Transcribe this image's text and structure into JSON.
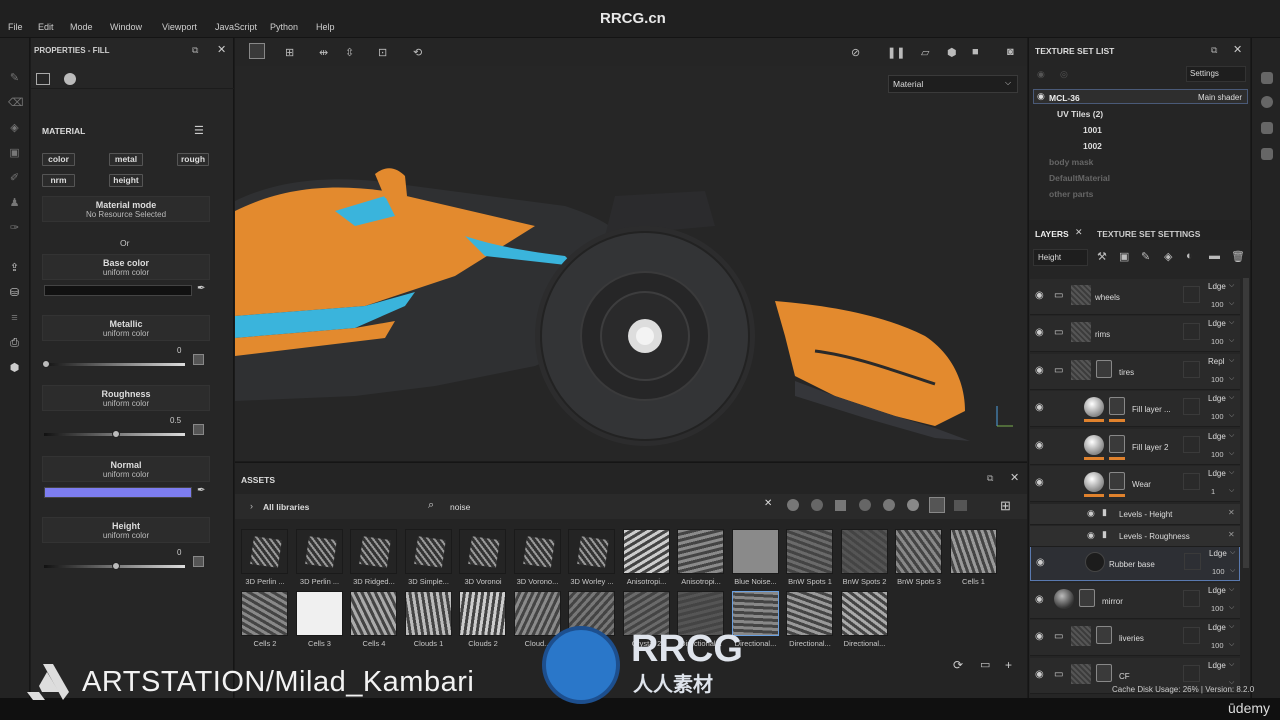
{
  "watermark": "RRCG.cn",
  "menu": [
    "File",
    "Edit",
    "Mode",
    "Window",
    "Viewport",
    "JavaScript",
    "Python",
    "Help"
  ],
  "properties": {
    "title": "PROPERTIES - FILL",
    "material_heading": "MATERIAL",
    "channels": [
      "color",
      "metal",
      "rough",
      "nrm",
      "height"
    ],
    "material_mode": {
      "label": "Material mode",
      "value": "No Resource Selected"
    },
    "or": "Or",
    "base_color": {
      "label": "Base color",
      "sub": "uniform color",
      "color": "#111111"
    },
    "metallic": {
      "label": "Metallic",
      "sub": "uniform color",
      "value": "0",
      "level": 0
    },
    "roughness": {
      "label": "Roughness",
      "sub": "uniform color",
      "value": "0.5",
      "level": 0.5
    },
    "normal": {
      "label": "Normal",
      "sub": "uniform color",
      "color": "#7d7df0"
    },
    "height": {
      "label": "Height",
      "sub": "uniform color",
      "value": "0",
      "level": 0.5
    }
  },
  "viewport": {
    "material_select": "Material"
  },
  "assets": {
    "title": "ASSETS",
    "library": "All libraries",
    "search": "noise",
    "row1": [
      "3D Perlin ...",
      "3D Perlin ...",
      "3D Ridged...",
      "3D Simple...",
      "3D Voronoi",
      "3D Vorono...",
      "3D Worley ...",
      "Anisotropi...",
      "Anisotropi...",
      "Blue Noise...",
      "BnW Spots 1",
      "BnW Spots 2",
      "BnW Spots 3",
      "Cells 1"
    ],
    "row2": [
      "Cells 2",
      "Cells 3",
      "Cells 4",
      "Clouds 1",
      "Clouds 2",
      "Cloud...",
      "",
      "Crystal 2",
      "Directional...",
      "Directional...",
      "Directional...",
      "Directional..."
    ]
  },
  "texture_set_list": {
    "title": "TEXTURE SET LIST",
    "settings": "Settings",
    "set_name": "MCL-36",
    "shader": "Main shader",
    "uv_tiles": "UV Tiles (2)",
    "tiles": [
      "1001",
      "1002"
    ],
    "others": [
      "body mask",
      "DefaultMaterial",
      "other parts"
    ]
  },
  "layers": {
    "tab_layers": "LAYERS",
    "tab_tss": "TEXTURE SET SETTINGS",
    "channel": "Height",
    "items": [
      {
        "name": "wheels",
        "blend": "Ldge",
        "opacity": "100"
      },
      {
        "name": "rims",
        "blend": "Ldge",
        "opacity": "100"
      },
      {
        "name": "tires",
        "blend": "Repl",
        "opacity": "100"
      },
      {
        "name": "Fill layer ...",
        "blend": "Ldge",
        "opacity": "100"
      },
      {
        "name": "Fill layer 2",
        "blend": "Ldge",
        "opacity": "100"
      },
      {
        "name": "Wear",
        "blend": "Ldge",
        "opacity": "1"
      },
      {
        "name": "Rubber base",
        "blend": "Ldge",
        "opacity": "100"
      },
      {
        "name": "mirror",
        "blend": "Ldge",
        "opacity": "100"
      },
      {
        "name": "liveries",
        "blend": "Ldge",
        "opacity": "100"
      },
      {
        "name": "CF",
        "blend": "Ldge",
        "opacity": ""
      }
    ],
    "effects": [
      "Levels - Height",
      "Levels - Roughness"
    ]
  },
  "status": {
    "cache": "Cache Disk Usage:  26% | Version: 8.2.0",
    "udemy": "ūdemy"
  },
  "branding": {
    "artstation": "ARTSTATION/Milad_Kambari",
    "rrcg": "RRCG",
    "rrcg_cn": "人人素材"
  }
}
